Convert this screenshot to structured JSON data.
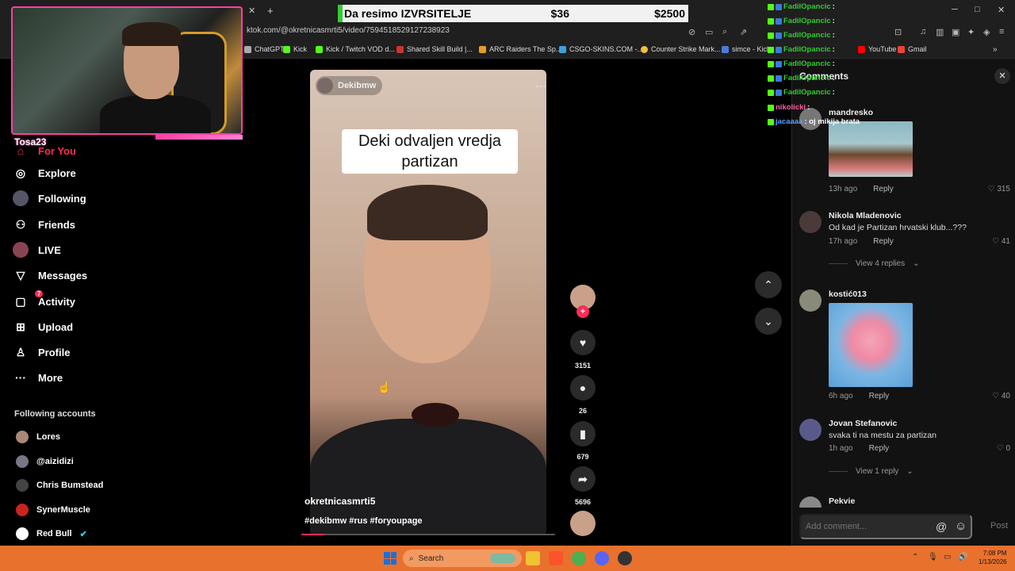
{
  "browser": {
    "url": "ktok.com/@okretnicasmrti5/video/7594518529127238923",
    "bookmarks": [
      "ChatGPT",
      "Kick",
      "Kick / Twitch VOD d...",
      "Shared Skill Build |...",
      "ARC Raiders The Sp...",
      "CSGO-SKINS.COM -...",
      "Counter Strike Mark...",
      "simce - Kick",
      "YouTube",
      "Gmail"
    ],
    "window_controls": {
      "minimize": "─",
      "maximize": "□",
      "close": "✕"
    }
  },
  "stream": {
    "streamer_name": "Tosa23",
    "donation_bar": {
      "text": "Da resimo IZVRSITELJE",
      "current": "$36",
      "goal": "$2500"
    }
  },
  "sidebar": {
    "partial_item": "For You",
    "items": [
      {
        "label": "Explore",
        "icon": "compass-icon"
      },
      {
        "label": "Following",
        "icon": "following-icon"
      },
      {
        "label": "Friends",
        "icon": "friends-icon"
      },
      {
        "label": "LIVE",
        "icon": "live-icon"
      },
      {
        "label": "Messages",
        "icon": "messages-icon"
      },
      {
        "label": "Activity",
        "icon": "activity-icon",
        "badge": "7"
      },
      {
        "label": "Upload",
        "icon": "upload-icon"
      },
      {
        "label": "Profile",
        "icon": "profile-icon"
      },
      {
        "label": "More",
        "icon": "more-icon"
      }
    ],
    "following_header": "Following accounts",
    "following_accounts": [
      "Lores",
      "@aizidizi",
      "Chris Bumstead",
      "SynerMuscle",
      "Red Bull"
    ]
  },
  "video": {
    "top_user": "Dekibmw",
    "caption": "Deki odvaljen vredja partizan",
    "author": "okretnicasmrti5",
    "hashtags": "#dekibmw #rus #foryoupage",
    "progress": 0.09,
    "actions": {
      "likes": "3151",
      "comments": "26",
      "saves": "679",
      "shares": "5696"
    }
  },
  "chat_overlay": [
    {
      "user": "FadilOpancic",
      "msg": ":",
      "color": "#33cc33"
    },
    {
      "user": "FadilOpancic",
      "msg": ":",
      "color": "#33cc33"
    },
    {
      "user": "FadilOpancic",
      "msg": ":",
      "color": "#33cc33"
    },
    {
      "user": "FadilOpancic",
      "msg": ":",
      "color": "#33cc33"
    },
    {
      "user": "FadilOpancic",
      "msg": ":",
      "color": "#33cc33"
    },
    {
      "user": "FadilOpancic",
      "msg": ":",
      "color": "#33cc33"
    },
    {
      "user": "FadilOpancic",
      "msg": ":",
      "color": "#33cc33"
    },
    {
      "user": "nikolicki",
      "msg": ":",
      "color": "#ff5fa2"
    },
    {
      "user": "jacaaaa",
      "msg": ": oj mikija brata",
      "color": "#5aa0ff"
    }
  ],
  "comments": {
    "header": "Comments",
    "list": [
      {
        "name": "mandresko",
        "text": "",
        "time": "13h ago",
        "reply": "Reply",
        "likes": "315"
      },
      {
        "name": "Nikola Mladenovic",
        "text": "Od kad je Partizan hrvatski klub...???",
        "time": "17h ago",
        "reply": "Reply",
        "likes": "41",
        "view_replies": "View 4 replies"
      },
      {
        "name": "kostić013",
        "text": "",
        "time": "6h ago",
        "reply": "Reply",
        "likes": "40"
      },
      {
        "name": "Jovan Stefanovic",
        "text": "svaka ti na mestu za partizan",
        "time": "1h ago",
        "reply": "Reply",
        "likes": "0",
        "view_replies": "View 1 reply"
      },
      {
        "name": "Pekvie",
        "text": ""
      }
    ],
    "add_placeholder": "Add comment...",
    "post_label": "Post"
  },
  "taskbar": {
    "search_label": "Search",
    "time": "7:08 PM",
    "date": "1/13/2026"
  }
}
